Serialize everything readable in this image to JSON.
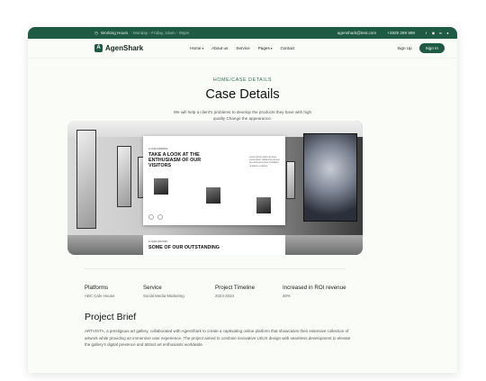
{
  "topbar": {
    "working_hours_label": "Working Hours",
    "working_hours_value": ": Monday - Friday, 10am - 05pm",
    "email": "agenshark@test.com",
    "phone": "+3929 299 999",
    "social": [
      "f",
      "◉",
      "in",
      "●"
    ]
  },
  "nav": {
    "brand": "AgenShark",
    "menu": [
      "Home",
      "About us",
      "Service",
      "Pages",
      "Contact"
    ],
    "sign_up": "Sign Up",
    "sign_in": "Sign In"
  },
  "hero": {
    "breadcrumb": "HOME/CASE DETAILS",
    "title": "Case Details",
    "subtitle": "We will help a client's problems to develop the products they have with high quality Change the appearance."
  },
  "showcase": {
    "eyebrow": "● OUR AWARDS",
    "headline": "TAKE A LOOK AT THE ENTHUSIASM OF OUR VISITORS",
    "side_text": "Lorem ipsum dolor sit amet consectetur adipiscing elit sed do eiusmod tempor incididunt ut labore et dolore",
    "eyebrow2": "● OUR HISTORY",
    "headline2": "SOME OF OUR OUTSTANDING"
  },
  "stats": [
    {
      "label": "Platforms",
      "value": "ABC Cafe House"
    },
    {
      "label": "Service",
      "value": "Social Media Marketing"
    },
    {
      "label": "Project Timeline",
      "value": "2023-2024"
    },
    {
      "label": "Increased in ROI revenue",
      "value": "30%"
    }
  ],
  "brief": {
    "title": "Project Brief",
    "text": "ARTVISTA, a prestigious art gallery, collaborated with AgenShark to create a captivating online platform that showcases their extensive collection of artwork while providing an immersive user experience. The project aimed to combine innovative UI/UX design with seamless development to elevate the gallery's digital presence and attract art enthusiasts worldwide."
  }
}
